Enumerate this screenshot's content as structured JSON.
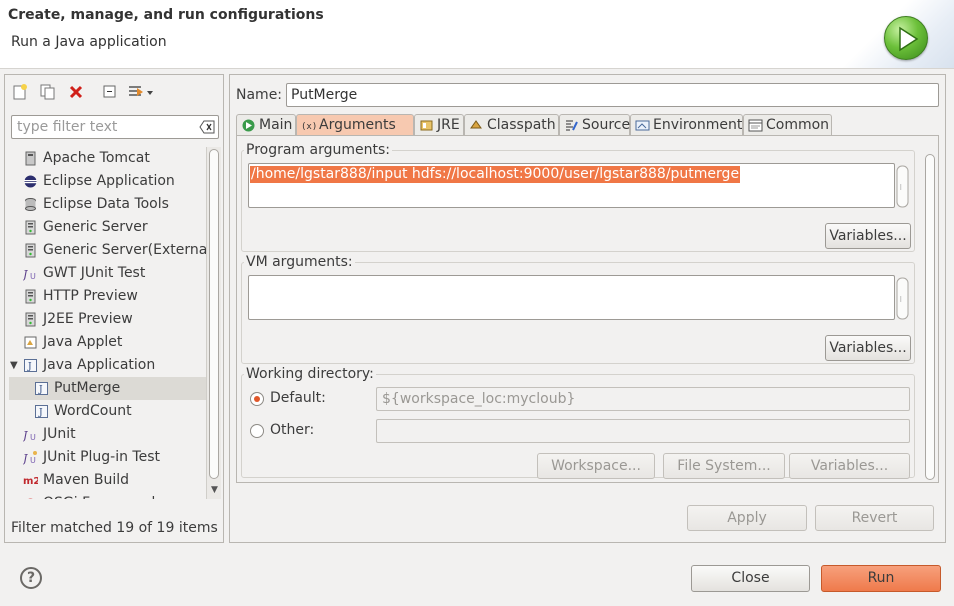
{
  "header": {
    "title": "Create, manage, and run configurations",
    "subtitle": "Run a Java application"
  },
  "left": {
    "filter_placeholder": "type filter text",
    "tree": [
      {
        "label": "Apache Tomcat",
        "icon": "tomcat-icon",
        "level": 0
      },
      {
        "label": "Eclipse Application",
        "icon": "eclipse-icon",
        "level": 0
      },
      {
        "label": "Eclipse Data Tools",
        "icon": "database-icon",
        "level": 0
      },
      {
        "label": "Generic Server",
        "icon": "server-icon",
        "level": 0
      },
      {
        "label": "Generic Server(External",
        "icon": "server-icon",
        "level": 0
      },
      {
        "label": "GWT JUnit Test",
        "icon": "junit-icon",
        "level": 0
      },
      {
        "label": "HTTP Preview",
        "icon": "server-icon",
        "level": 0
      },
      {
        "label": "J2EE Preview",
        "icon": "server-icon",
        "level": 0
      },
      {
        "label": "Java Applet",
        "icon": "applet-icon",
        "level": 0
      },
      {
        "label": "Java Application",
        "icon": "java-app-icon",
        "level": 0,
        "expanded": true
      },
      {
        "label": "PutMerge",
        "icon": "java-app-icon",
        "level": 1,
        "selected": true
      },
      {
        "label": "WordCount",
        "icon": "java-app-icon",
        "level": 1
      },
      {
        "label": "JUnit",
        "icon": "junit-icon",
        "level": 0
      },
      {
        "label": "JUnit Plug-in Test",
        "icon": "junit-plugin-icon",
        "level": 0
      },
      {
        "label": "Maven Build",
        "icon": "maven-icon",
        "level": 0
      },
      {
        "label": "OSGi Framework",
        "icon": "osgi-icon",
        "level": 0
      }
    ],
    "status": "Filter matched 19 of 19 items"
  },
  "right": {
    "name_label": "Name:",
    "name_value": "PutMerge",
    "tabs": [
      {
        "label": "Main",
        "icon": "main-tab-icon"
      },
      {
        "label": "Arguments",
        "icon": "arguments-tab-icon",
        "active": true
      },
      {
        "label": "JRE",
        "icon": "jre-tab-icon"
      },
      {
        "label": "Classpath",
        "icon": "classpath-tab-icon"
      },
      {
        "label": "Source",
        "icon": "source-tab-icon"
      },
      {
        "label": "Environment",
        "icon": "environment-tab-icon"
      },
      {
        "label": "Common",
        "icon": "common-tab-icon"
      }
    ],
    "program_args_label": "Program arguments:",
    "program_args_value": "/home/lgstar888/input hdfs://localhost:9000/user/lgstar888/putmerge",
    "variables_label": "Variables...",
    "vm_args_label": "VM arguments:",
    "vm_args_value": "",
    "working_dir_label": "Working directory:",
    "default_label": "Default:",
    "default_value": "${workspace_loc:mycloub}",
    "other_label": "Other:",
    "other_value": "",
    "workspace_label": "Workspace...",
    "filesystem_label": "File System...",
    "apply_label": "Apply",
    "revert_label": "Revert"
  },
  "footer": {
    "help": "?",
    "close_label": "Close",
    "run_label": "Run"
  },
  "colors": {
    "accent": "#ef7a4b",
    "selection": "#f07746",
    "run_green": "#6cc03a"
  }
}
